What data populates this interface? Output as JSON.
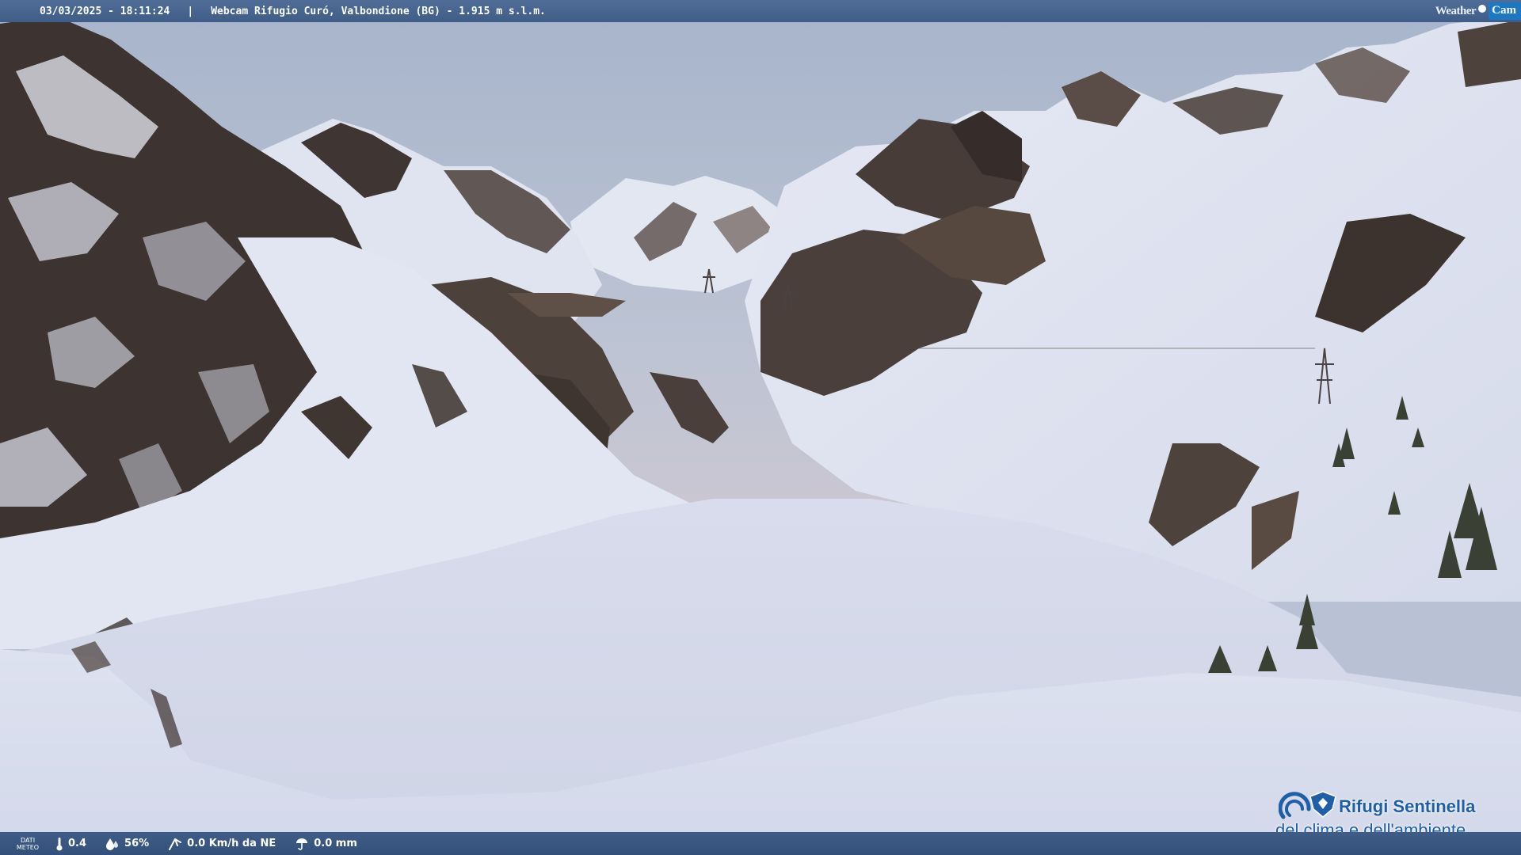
{
  "header": {
    "timestamp": "03/03/2025 - 18:11:24",
    "separator": "|",
    "title": "Webcam Rifugio Curó, Valbondione (BG) - 1.915 m s.l.m.",
    "brand_left": "Weather",
    "brand_right": "Cam"
  },
  "footer": {
    "dati_line1": "DATI",
    "dati_line2": "METEO",
    "temperature": "0.4",
    "humidity": "56%",
    "wind": "0.0 Km/h da NE",
    "rain": "0.0 mm",
    "icons": [
      "thermometer-icon",
      "humidity-icon",
      "wind-icon",
      "rain-icon"
    ]
  },
  "logo": {
    "line1": "Rifugi Sentinella",
    "line2": "del clima e dell'ambiente",
    "color": "#1f5fa8"
  },
  "colors": {
    "sky_top": "#a9b6cc",
    "sky_horizon": "#c9c6d2",
    "snow": "#dfe4f1",
    "rock": "#4a3f3a",
    "bar": "#3f5d86"
  }
}
